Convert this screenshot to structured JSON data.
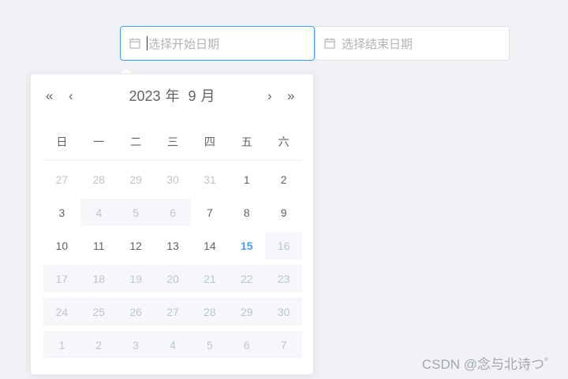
{
  "start_input": {
    "placeholder": "选择开始日期",
    "icon": "calendar-icon"
  },
  "end_input": {
    "placeholder": "选择结束日期",
    "icon": "calendar-icon"
  },
  "picker": {
    "year": "2023",
    "year_unit": "年",
    "month": "9",
    "month_unit": "月",
    "nav": {
      "prev_year": "«",
      "prev_month": "‹",
      "next_month": "›",
      "next_year": "»"
    },
    "weekdays": [
      "日",
      "一",
      "二",
      "三",
      "四",
      "五",
      "六"
    ],
    "weeks": [
      [
        {
          "d": "27",
          "s": "other"
        },
        {
          "d": "28",
          "s": "other"
        },
        {
          "d": "29",
          "s": "other"
        },
        {
          "d": "30",
          "s": "other"
        },
        {
          "d": "31",
          "s": "other"
        },
        {
          "d": "1",
          "s": "normal"
        },
        {
          "d": "2",
          "s": "normal"
        }
      ],
      [
        {
          "d": "3",
          "s": "normal"
        },
        {
          "d": "4",
          "s": "disabled"
        },
        {
          "d": "5",
          "s": "disabled"
        },
        {
          "d": "6",
          "s": "disabled"
        },
        {
          "d": "7",
          "s": "normal"
        },
        {
          "d": "8",
          "s": "normal"
        },
        {
          "d": "9",
          "s": "normal"
        }
      ],
      [
        {
          "d": "10",
          "s": "normal"
        },
        {
          "d": "11",
          "s": "normal"
        },
        {
          "d": "12",
          "s": "normal"
        },
        {
          "d": "13",
          "s": "normal"
        },
        {
          "d": "14",
          "s": "normal"
        },
        {
          "d": "15",
          "s": "today"
        },
        {
          "d": "16",
          "s": "disabled"
        }
      ],
      [
        {
          "d": "17",
          "s": "disabled"
        },
        {
          "d": "18",
          "s": "disabled"
        },
        {
          "d": "19",
          "s": "disabled"
        },
        {
          "d": "20",
          "s": "disabled"
        },
        {
          "d": "21",
          "s": "disabled"
        },
        {
          "d": "22",
          "s": "disabled"
        },
        {
          "d": "23",
          "s": "disabled"
        }
      ],
      [
        {
          "d": "24",
          "s": "disabled"
        },
        {
          "d": "25",
          "s": "disabled"
        },
        {
          "d": "26",
          "s": "disabled"
        },
        {
          "d": "27",
          "s": "disabled"
        },
        {
          "d": "28",
          "s": "disabled"
        },
        {
          "d": "29",
          "s": "disabled"
        },
        {
          "d": "30",
          "s": "disabled"
        }
      ],
      [
        {
          "d": "1",
          "s": "disabled"
        },
        {
          "d": "2",
          "s": "disabled"
        },
        {
          "d": "3",
          "s": "disabled"
        },
        {
          "d": "4",
          "s": "disabled"
        },
        {
          "d": "5",
          "s": "disabled"
        },
        {
          "d": "6",
          "s": "disabled"
        },
        {
          "d": "7",
          "s": "disabled"
        }
      ]
    ]
  },
  "watermark": "CSDN @念与北诗つ゜",
  "colors": {
    "accent": "#409eff",
    "disabled_bg": "#f5f7fa",
    "muted": "#c0c4cc"
  }
}
